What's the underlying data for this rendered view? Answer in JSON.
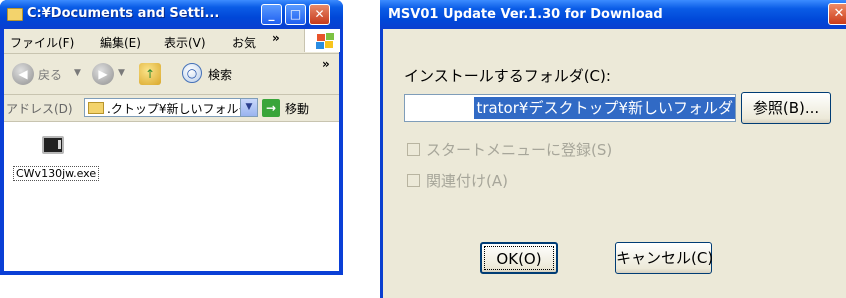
{
  "explorer": {
    "title": "C:¥Documents and Setti...",
    "controls": {
      "minimize": "_",
      "maximize": "□",
      "close": "✕"
    },
    "menu": [
      "ファイル(F)",
      "編集(E)",
      "表示(V)",
      "お気"
    ],
    "menu_overflow": "»",
    "toolbar": {
      "back_label": "戻る",
      "back_glyph": "◀",
      "forward_glyph": "▶",
      "up_glyph": "↑",
      "search_label": "検索",
      "overflow": "»"
    },
    "address": {
      "label": "アドレス(D)",
      "value": ".クトップ¥新しいフォルダ",
      "go_label": "移動",
      "go_glyph": "→",
      "dropdown_glyph": "▼"
    },
    "files": [
      {
        "name": "CWv130jw.exe"
      }
    ]
  },
  "dialog": {
    "title": "MSV01 Update Ver.1.30 for Download",
    "close_glyph": "✕",
    "folder_label": "インストールするフォルダ(C):",
    "folder_value": "trator¥デスクトップ¥新しいフォルダ",
    "browse_button": "参照(B)...",
    "checkbox_startmenu": "スタートメニューに登録(S)",
    "checkbox_associate": "関連付け(A)",
    "ok_button": "OK(O)",
    "cancel_button": "キャンセル(C)"
  },
  "colors": {
    "xp_blue": "#0a5ce6",
    "selection": "#316ac5",
    "dialog_face": "#ece9d8",
    "close_red": "#cb3c1a"
  }
}
